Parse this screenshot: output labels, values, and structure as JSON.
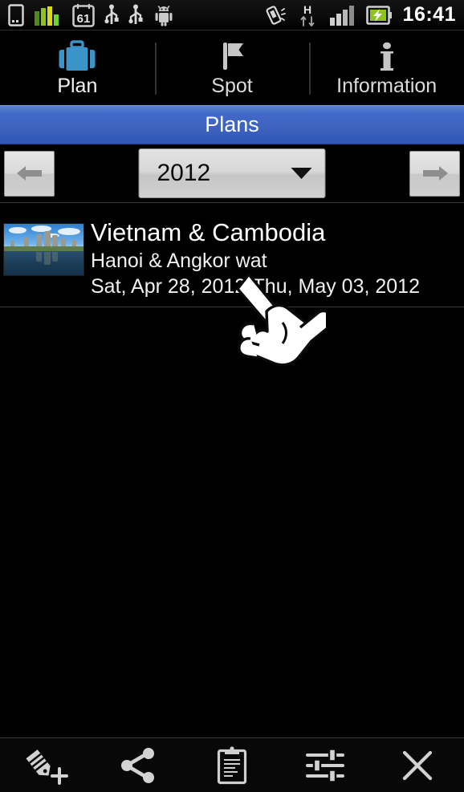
{
  "statusbar": {
    "left_icons": [
      {
        "name": "device-icon",
        "label": "phone"
      },
      {
        "name": "signal-bars-green-icon",
        "label": "signal"
      },
      {
        "name": "calendar-icon",
        "label": "calendar",
        "value": "61"
      },
      {
        "name": "usb-icon",
        "label": "usb"
      },
      {
        "name": "usb-icon-2",
        "label": "usb"
      },
      {
        "name": "android-robot-icon",
        "label": "android"
      }
    ],
    "right_icons": [
      {
        "name": "vibrate-icon",
        "label": "vibrate"
      },
      {
        "name": "hspa-data-icon",
        "label": "H",
        "sub": "arrows"
      },
      {
        "name": "signal-strength-icon",
        "label": "signal"
      },
      {
        "name": "battery-charging-icon",
        "label": "battery"
      }
    ],
    "calendar_badge": "61",
    "data_type": "H",
    "clock": "16:41"
  },
  "tabs": [
    {
      "label": "Plan",
      "icon": "suitcase-icon",
      "active": true
    },
    {
      "label": "Spot",
      "icon": "flag-icon",
      "active": false
    },
    {
      "label": "Information",
      "icon": "info-icon",
      "active": false
    }
  ],
  "titlebar": {
    "title": "Plans"
  },
  "yearbar": {
    "prev_label": "arrow-left-icon",
    "next_label": "arrow-right-icon",
    "year": "2012"
  },
  "plans": [
    {
      "title": "Vietnam & Cambodia",
      "subtitle": "Hanoi & Angkor wat",
      "dates": "Sat, Apr 28, 2012-Thu, May 03, 2012",
      "thumbnail": "angkor-wat-photo"
    }
  ],
  "bottombar": [
    {
      "name": "add-plan-icon",
      "label": "Add plan"
    },
    {
      "name": "share-icon",
      "label": "Share"
    },
    {
      "name": "clipboard-icon",
      "label": "Notes"
    },
    {
      "name": "settings-sliders-icon",
      "label": "Settings"
    },
    {
      "name": "close-icon",
      "label": "Close"
    }
  ],
  "cursor": {
    "name": "hand-pointer-cursor"
  },
  "colors": {
    "accent_blue": "#3f63bf",
    "tab_active": "#3a94c8",
    "background": "#000000",
    "button_face": "#d7d7d7",
    "divider": "#3a3a3a"
  }
}
